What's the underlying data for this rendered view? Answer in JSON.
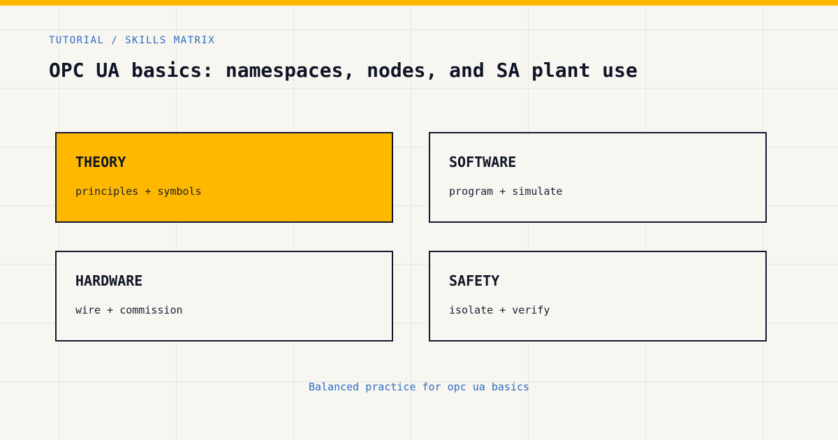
{
  "header": {
    "breadcrumb": "TUTORIAL / SKILLS MATRIX",
    "title": "OPC UA basics: namespaces, nodes, and SA plant use"
  },
  "colors": {
    "accent": "#ffb800",
    "link": "#2f6cc4",
    "ink": "#0f1526",
    "background": "#f7f6f1"
  },
  "matrix": {
    "cards": [
      {
        "title": "THEORY",
        "description": "principles + symbols",
        "active": true
      },
      {
        "title": "SOFTWARE",
        "description": "program + simulate",
        "active": false
      },
      {
        "title": "HARDWARE",
        "description": "wire + commission",
        "active": false
      },
      {
        "title": "SAFETY",
        "description": "isolate + verify",
        "active": false
      }
    ]
  },
  "footer": {
    "note": "Balanced practice for opc ua basics"
  }
}
